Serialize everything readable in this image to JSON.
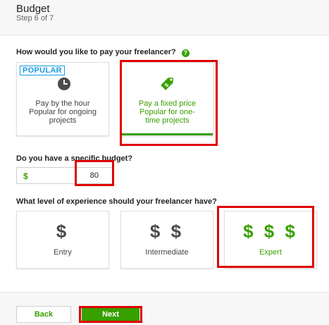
{
  "header": {
    "title": "Budget",
    "step": "Step 6 of 7"
  },
  "payment": {
    "question": "How would you like to pay your freelancer?",
    "help_icon": "?",
    "hourly": {
      "badge": "POPULAR",
      "icon": "clock-icon",
      "label": "Pay by the hour",
      "sub1": "Popular for ongoing",
      "sub2": "projects"
    },
    "fixed": {
      "icon": "price-tag-icon",
      "label": "Pay a fixed price",
      "sub1": "Popular for one-",
      "sub2": "time projects",
      "selected": true
    }
  },
  "budget": {
    "question": "Do you have a specific budget?",
    "currency": "$",
    "value": "80"
  },
  "experience": {
    "question": "What level of experience should your freelancer have?",
    "options": [
      {
        "symbol": "$",
        "label": "Entry",
        "selected": false
      },
      {
        "symbol": "$ $",
        "label": "Intermediate",
        "selected": false
      },
      {
        "symbol": "$ $ $",
        "label": "Expert",
        "selected": true
      }
    ]
  },
  "footer": {
    "back_label": "Back",
    "next_label": "Next"
  },
  "colors": {
    "accent": "#37a000",
    "highlight": "#e00000",
    "badge": "#1a9ce0"
  }
}
